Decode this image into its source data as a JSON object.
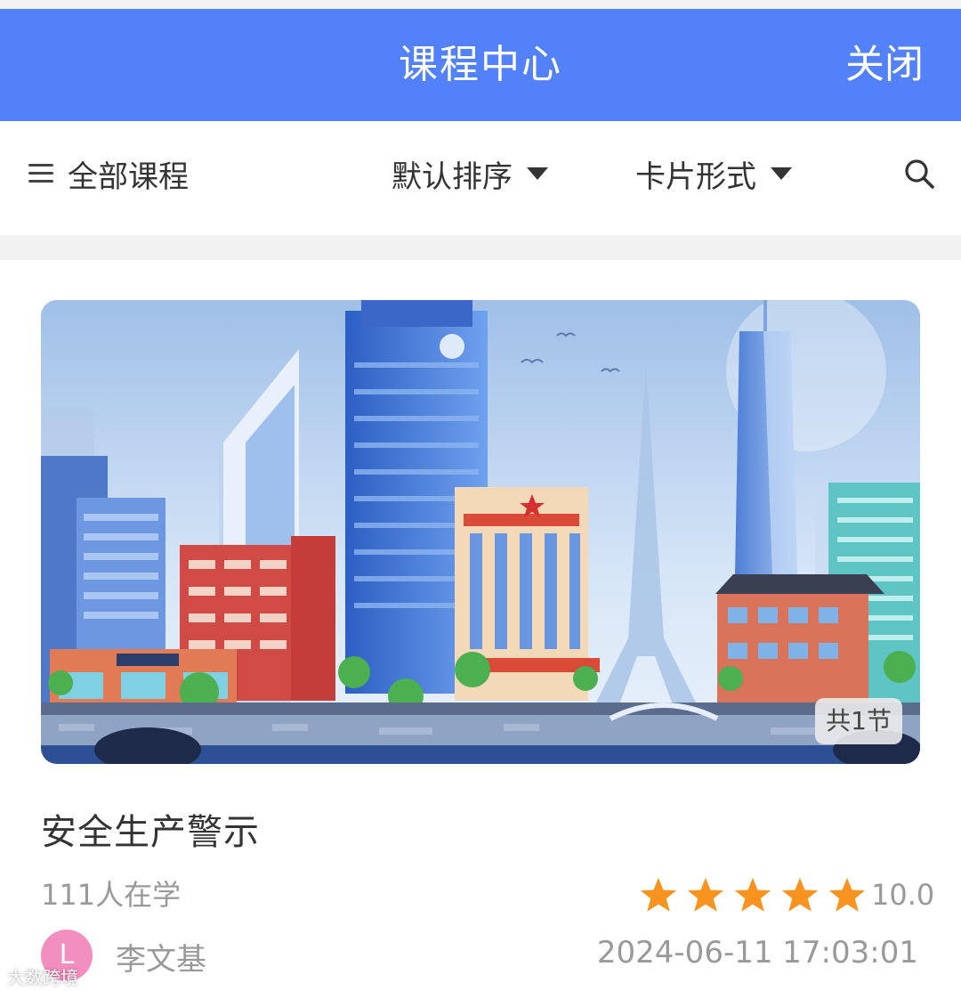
{
  "header": {
    "title": "课程中心",
    "close_label": "关闭",
    "bg_color": "#5281fa"
  },
  "toolbar": {
    "all_courses_label": "全部课程",
    "sort_label": "默认排序",
    "view_label": "卡片形式",
    "icons": [
      "menu-icon",
      "caret-down-icon",
      "search-icon"
    ]
  },
  "course": {
    "lessons_badge": "共1节",
    "title": "安全生产警示",
    "learners": "111人在学",
    "stars": 5,
    "rating": "10.0",
    "star_color": "#f7931e",
    "author_initial": "L",
    "author": "李文基",
    "date": "2024-06-11 17:03:01"
  },
  "watermark": "大数跨境"
}
